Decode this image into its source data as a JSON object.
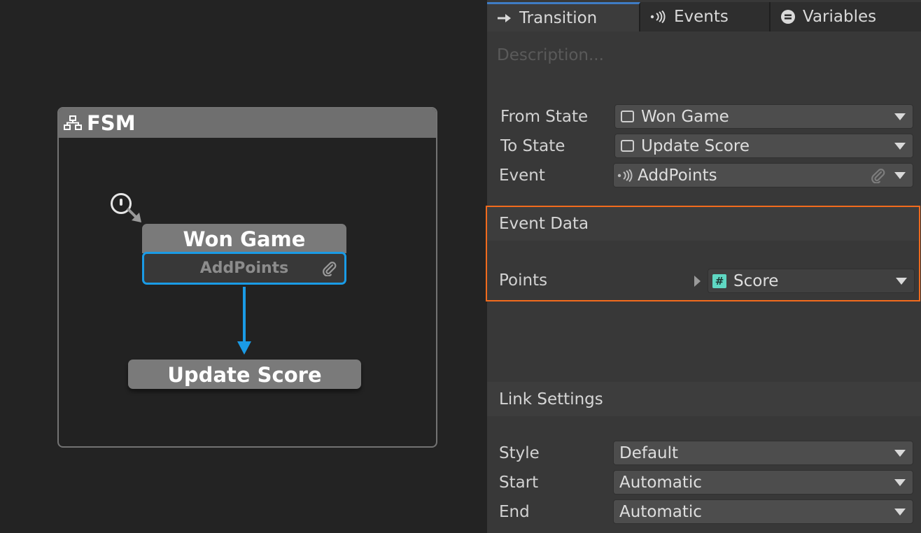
{
  "fsm": {
    "title": "FSM",
    "nodes": [
      {
        "name": "Won Game",
        "event": "AddPoints"
      },
      {
        "name": "Update Score"
      }
    ]
  },
  "inspector": {
    "tabs": [
      {
        "label": "Transition",
        "icon": "arrow-right-icon",
        "active": true
      },
      {
        "label": "Events",
        "icon": "broadcast-icon",
        "active": false
      },
      {
        "label": "Variables",
        "icon": "variables-icon",
        "active": false
      }
    ],
    "description_placeholder": "Description...",
    "fields": {
      "from_state": {
        "label": "From State",
        "value": "Won Game"
      },
      "to_state": {
        "label": "To State",
        "value": "Update Score"
      },
      "event": {
        "label": "Event",
        "value": "AddPoints"
      }
    },
    "event_data": {
      "title": "Event Data",
      "points": {
        "label": "Points",
        "value": "Score",
        "icon": "#"
      }
    },
    "link_settings": {
      "title": "Link Settings",
      "style": {
        "label": "Style",
        "value": "Default"
      },
      "start": {
        "label": "Start",
        "value": "Automatic"
      },
      "end": {
        "label": "End",
        "value": "Automatic"
      }
    }
  },
  "colors": {
    "selection_blue": "#1a9be6",
    "highlight_orange": "#f26b1d",
    "float_icon": "#5fd8c3"
  }
}
